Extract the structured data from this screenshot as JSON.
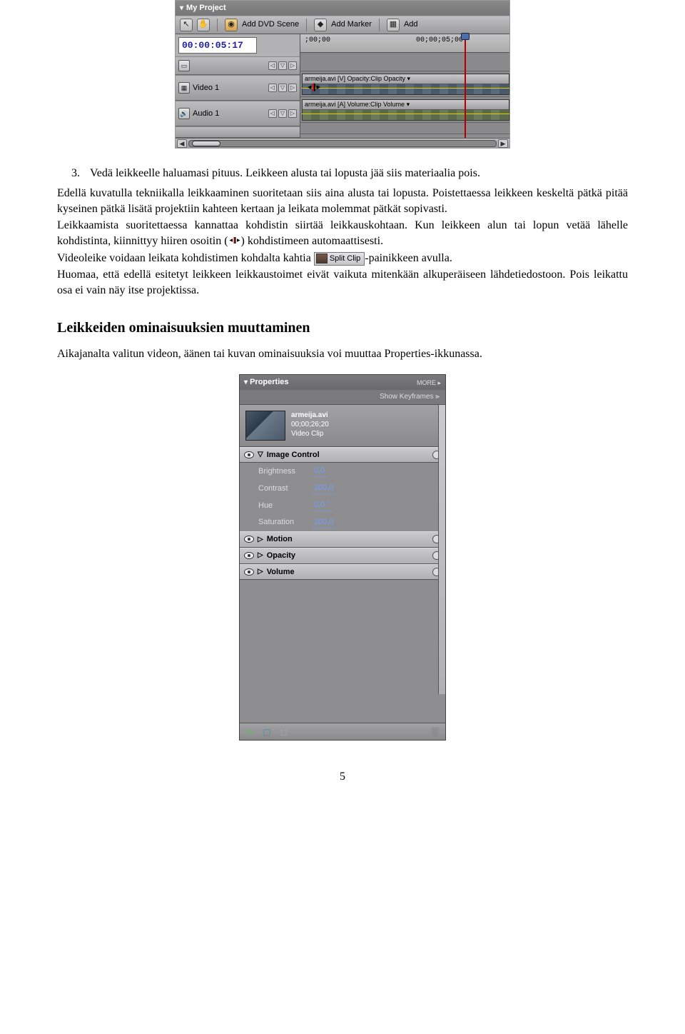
{
  "page_number": "5",
  "timeline": {
    "panel_title": "My Project",
    "add_dvd_scene": "Add DVD Scene",
    "add_marker": "Add Marker",
    "add_partial": "Add",
    "timecode": "00:00:05:17",
    "ruler_t1": ";00;00",
    "ruler_t2": "00;00;05;00",
    "track_video": "Video 1",
    "track_audio": "Audio 1",
    "clip_video_label": "armeija.avi [V] Opacity:Clip Opacity ▾",
    "clip_audio_label": "armeija.avi [A] Volume:Clip Volume ▾"
  },
  "body": {
    "item3_num": "3.",
    "item3_text": "Vedä leikkeelle haluamasi pituus. Leikkeen alusta tai lopusta jää siis materiaalia pois.",
    "para1": "Edellä kuvatulla tekniikalla leikkaaminen suoritetaan siis aina alusta tai lopusta. Poistettaessa leikkeen keskeltä pätkä pitää kyseinen pätkä lisätä projektiin kahteen kertaan ja leikata molemmat pätkät sopivasti.",
    "para2_a": "Leikkaamista suoritettaessa kannattaa kohdistin siirtää leikkauskohtaan. Kun leikkeen alun tai lopun vetää lähelle kohdistinta, kiinnittyy hiiren osoitin (",
    "para2_b": ") kohdistimeen automaattisesti.",
    "para3_a": "Videoleike voidaan leikata kohdistimen kohdalta kahtia ",
    "split_clip": "Split Clip",
    "para3_b": "-painikkeen avulla.",
    "para4": "Huomaa, että edellä esitetyt leikkeen leikkaustoimet eivät vaikuta mitenkään alkuperäiseen lähdetiedostoon. Pois leikattu osa ei vain näy itse projektissa.",
    "heading": "Leikkeiden ominaisuuksien muuttaminen",
    "para5": "Aikajanalta valitun videon, äänen tai kuvan ominaisuuksia voi muuttaa Properties-ikkunassa."
  },
  "properties": {
    "title": "Properties",
    "more": "MORE ▸",
    "show_keyframes": "Show Keyframes ⫸",
    "clip_name": "armeija.avi",
    "clip_duration": "00;00;26;20",
    "clip_type": "Video Clip",
    "group_image": "Image Control",
    "brightness_label": "Brightness",
    "brightness_val": "0,0",
    "contrast_label": "Contrast",
    "contrast_val": "100,0",
    "hue_label": "Hue",
    "hue_val": "0,0 °",
    "saturation_label": "Saturation",
    "saturation_val": "100,0",
    "group_motion": "Motion",
    "group_opacity": "Opacity",
    "group_volume": "Volume"
  }
}
